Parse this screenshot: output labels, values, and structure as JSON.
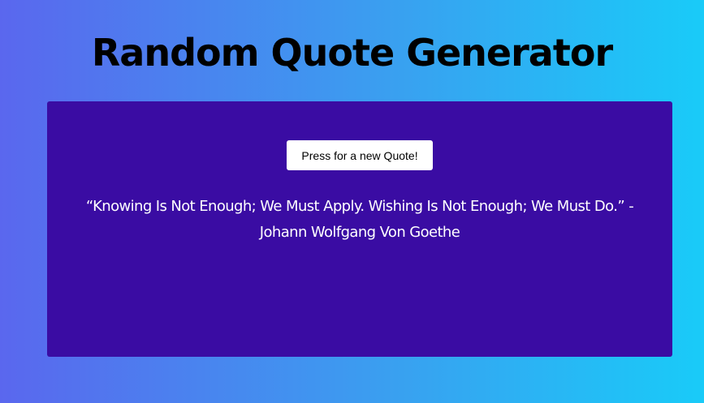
{
  "header": {
    "title": "Random Quote Generator"
  },
  "quote_card": {
    "button_label": "Press for a new Quote!",
    "quote_text": "“Knowing Is Not Enough; We Must Apply. Wishing Is Not Enough; We Must Do.” - Johann Wolfgang Von Goethe"
  },
  "colors": {
    "background_gradient_start": "#5a67ee",
    "background_gradient_end": "#19cbf8",
    "card_background": "#3a0ca3",
    "button_background": "#ffffff",
    "title_color": "#000000",
    "quote_color": "#ffffff"
  }
}
